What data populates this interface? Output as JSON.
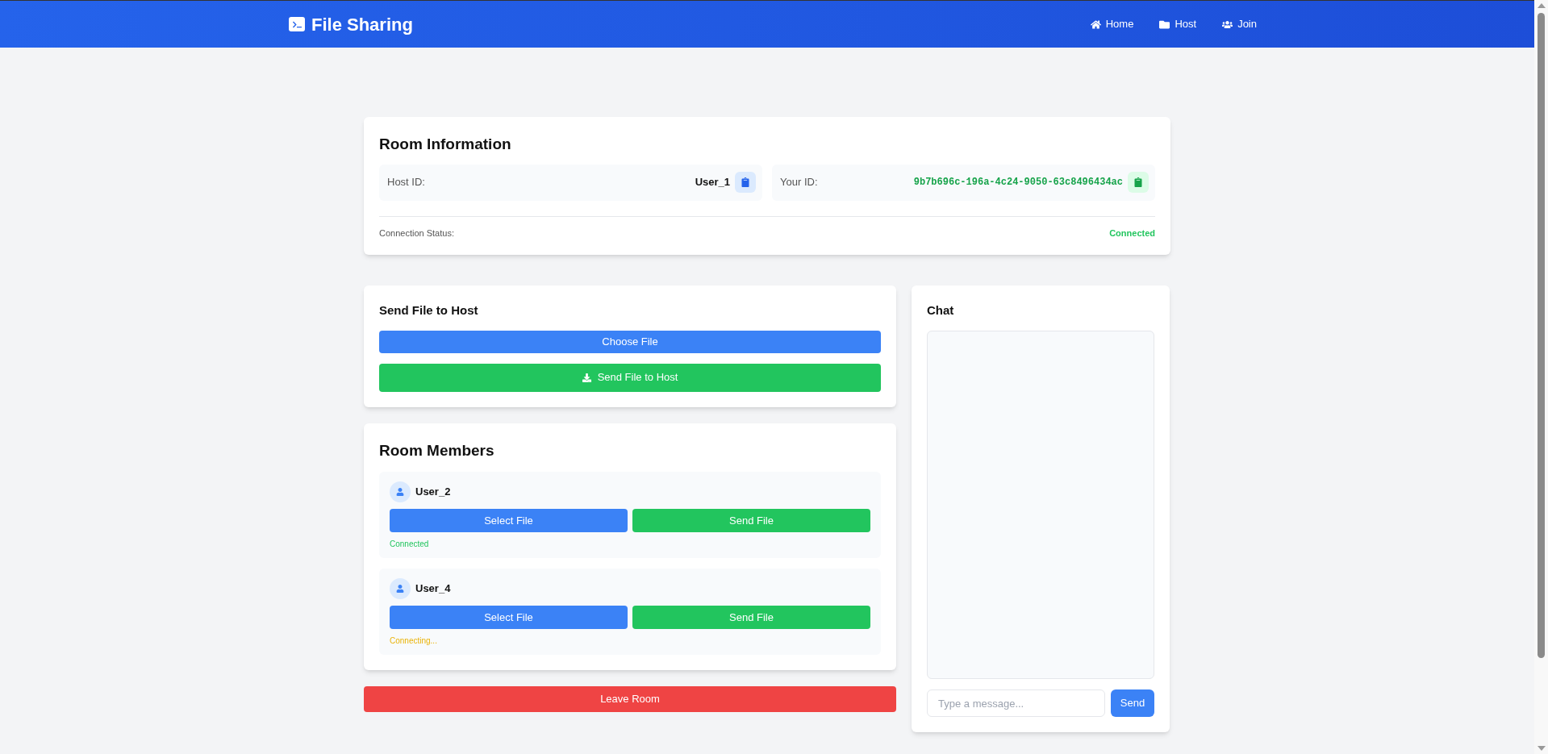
{
  "navbar": {
    "brand": "File Sharing",
    "links": [
      {
        "label": "Home",
        "kind": "home"
      },
      {
        "label": "Host",
        "kind": "folder"
      },
      {
        "label": "Join",
        "kind": "users"
      }
    ]
  },
  "room_info": {
    "title": "Room Information",
    "host_id": {
      "label": "Host ID:",
      "value": "User_1"
    },
    "your_id": {
      "label": "Your ID:",
      "value": "9b7b696c-196a-4c24-9050-63c8496434ac"
    },
    "connection": {
      "label": "Connection Status:",
      "value": "Connected",
      "kind": "connected"
    }
  },
  "send_to_host": {
    "title": "Send File to Host",
    "choose_button": "Choose File",
    "send_button": "Send File to Host"
  },
  "members": {
    "title": "Room Members",
    "items": [
      {
        "name": "User_2",
        "select_button": "Select File",
        "send_button": "Send File",
        "status": "Connected",
        "kind": "connected"
      },
      {
        "name": "User_4",
        "select_button": "Select File",
        "send_button": "Send File",
        "status": "Connecting...",
        "kind": "connecting"
      }
    ]
  },
  "leave_button": "Leave Room",
  "chat": {
    "title": "Chat",
    "input": {
      "placeholder": "Type a message..."
    },
    "send_button": "Send"
  }
}
